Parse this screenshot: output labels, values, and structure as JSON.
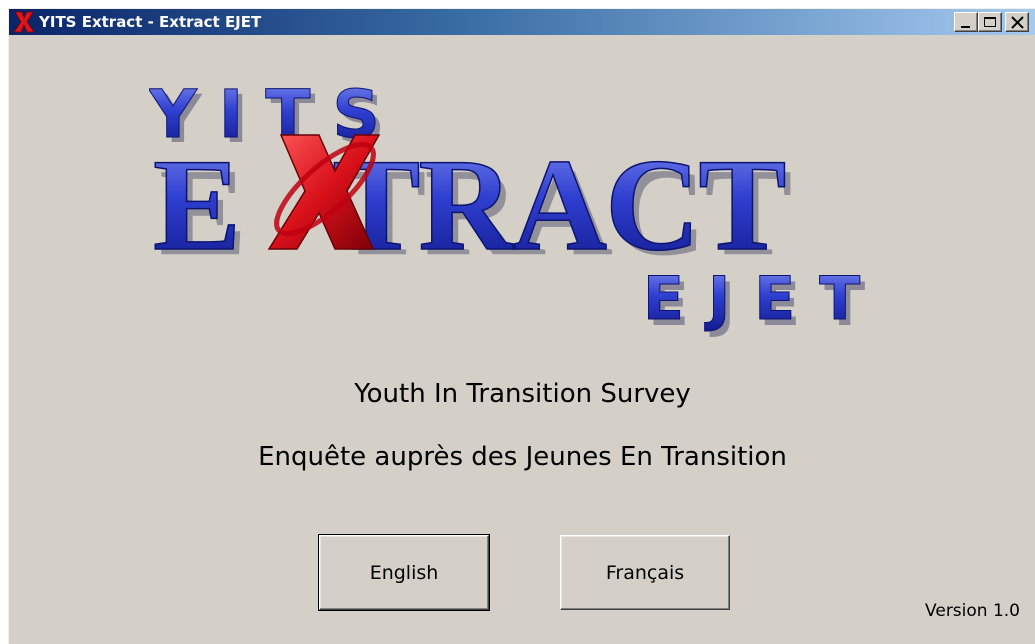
{
  "window": {
    "title": "YITS Extract - Extract EJET",
    "app_icon": "x-letter-icon",
    "controls": [
      "minimize-icon",
      "maximize-icon",
      "close-icon"
    ]
  },
  "logo": {
    "line1": "YITS",
    "line2": "EXTRACT",
    "line3": "EJET",
    "colors": {
      "blue": "#2a3fc8",
      "red": "#d8101a"
    }
  },
  "survey": {
    "english": "Youth In Transition Survey",
    "french": "Enquête auprès des Jeunes En Transition"
  },
  "buttons": {
    "english": "English",
    "french": "Français"
  },
  "version": "Version 1.0",
  "colors": {
    "face": "#d4d0c8",
    "title_start": "#0a246a",
    "title_end": "#a6caf0"
  }
}
